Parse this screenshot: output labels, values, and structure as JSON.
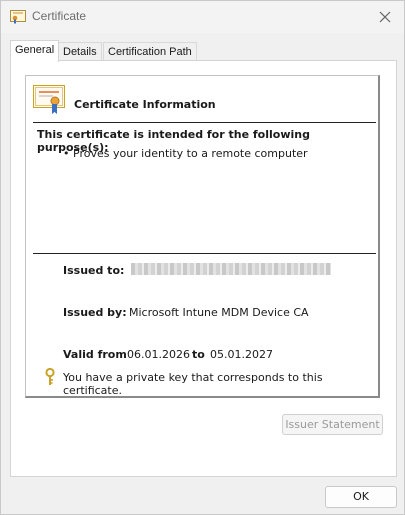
{
  "window": {
    "title": "Certificate"
  },
  "tabs": [
    {
      "label": "General",
      "active": true
    },
    {
      "label": "Details",
      "active": false
    },
    {
      "label": "Certification Path",
      "active": false
    }
  ],
  "general": {
    "heading": "Certificate Information",
    "purpose_heading": "This certificate is intended for the following purpose(s):",
    "purposes": [
      "Proves your identity to a remote computer"
    ],
    "issued_to_label": "Issued to:",
    "issued_to_value": "",
    "issued_by_label": "Issued by:",
    "issued_by_value": "Microsoft Intune MDM Device CA",
    "valid_from_label": "Valid from",
    "valid_from": "06.01.2026",
    "valid_to_label": "to",
    "valid_to": "05.01.2027",
    "private_key_note": "You have a private key that corresponds to this certificate."
  },
  "buttons": {
    "issuer_statement": "Issuer Statement",
    "ok": "OK"
  },
  "colors": {
    "window_bg": "#f0f0f0",
    "panel_bg": "#ffffff",
    "title_text": "#6d6d6d",
    "disabled_text": "#9a9a9a",
    "key_gold": "#c9a227"
  },
  "icons": {
    "title": "certificate-icon",
    "close": "close-icon",
    "heading": "certificate-icon",
    "private_key": "key-icon"
  }
}
